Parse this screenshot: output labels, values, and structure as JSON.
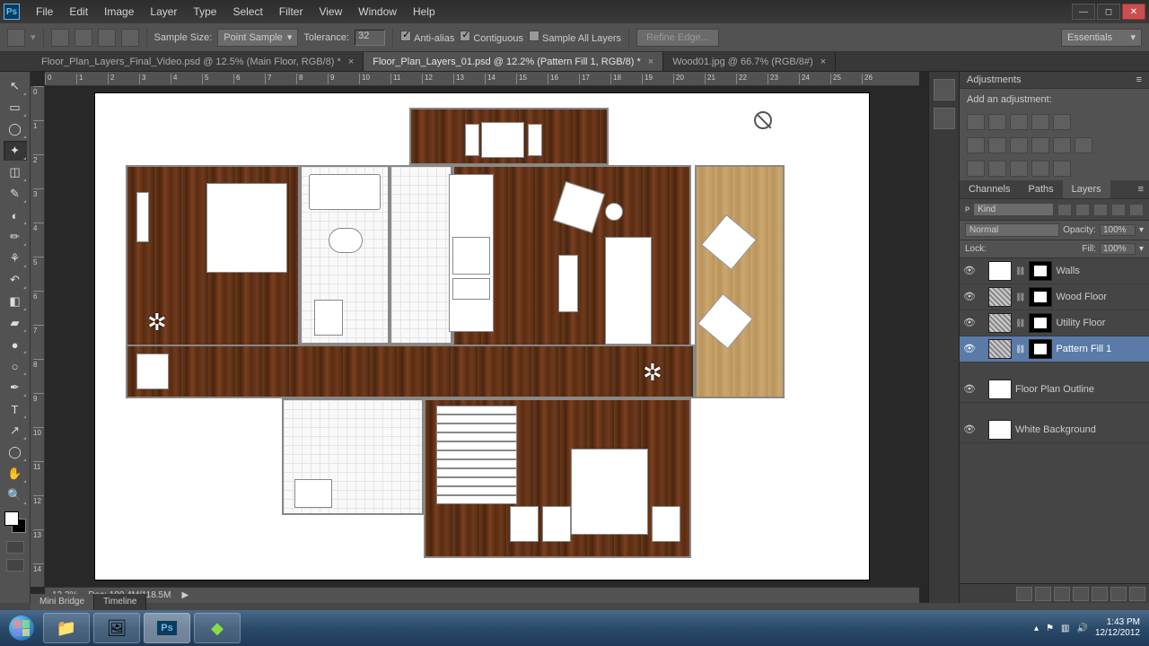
{
  "app": {
    "name": "Ps"
  },
  "menu": [
    "File",
    "Edit",
    "Image",
    "Layer",
    "Type",
    "Select",
    "Filter",
    "View",
    "Window",
    "Help"
  ],
  "options": {
    "sampleSizeLabel": "Sample Size:",
    "sampleSize": "Point Sample",
    "toleranceLabel": "Tolerance:",
    "tolerance": "32",
    "antiAlias": "Anti-alias",
    "contiguous": "Contiguous",
    "sampleAll": "Sample All Layers",
    "refineEdge": "Refine Edge..."
  },
  "workspace": "Essentials",
  "tabs": [
    {
      "label": "Floor_Plan_Layers_Final_Video.psd @ 12.5% (Main Floor, RGB/8) *",
      "active": false
    },
    {
      "label": "Floor_Plan_Layers_01.psd @ 12.2% (Pattern Fill 1, RGB/8) *",
      "active": true
    },
    {
      "label": "Wood01.jpg @ 66.7% (RGB/8#)",
      "active": false
    }
  ],
  "status": {
    "zoom": "12.2%",
    "doc": "Doc: 100.4M/118.5M"
  },
  "adjustments": {
    "title": "Adjustments",
    "addLabel": "Add an adjustment:"
  },
  "layersPanel": {
    "tabs": [
      "Channels",
      "Paths",
      "Layers"
    ],
    "kindLabel": "Kind",
    "blendMode": "Normal",
    "opacityLabel": "Opacity:",
    "opacity": "100%",
    "lockLabel": "Lock:",
    "fillLabel": "Fill:",
    "fill": "100%"
  },
  "layers": [
    {
      "name": "Walls",
      "masked": true,
      "thumb": "white"
    },
    {
      "name": "Wood Floor",
      "masked": true,
      "thumb": "pat"
    },
    {
      "name": "Utility Floor",
      "masked": true,
      "thumb": "pat"
    },
    {
      "name": "Pattern Fill 1",
      "masked": true,
      "thumb": "pat",
      "selected": true
    },
    {
      "name": "Floor Plan Outline",
      "masked": false,
      "thumb": "white"
    },
    {
      "name": "White Background",
      "masked": false,
      "thumb": "white"
    }
  ],
  "bottomTabs": [
    "Mini Bridge",
    "Timeline"
  ],
  "taskbar": {
    "time": "1:43 PM",
    "date": "12/12/2012"
  },
  "rulerH": [
    0,
    1,
    2,
    3,
    4,
    5,
    6,
    7,
    8,
    9,
    10,
    11,
    12,
    13,
    14,
    15,
    16,
    17,
    18,
    19,
    20,
    21,
    22,
    23,
    24,
    25,
    26
  ],
  "rulerV": [
    0,
    1,
    2,
    3,
    4,
    5,
    6,
    7,
    8,
    9,
    10,
    11,
    12,
    13,
    14
  ]
}
